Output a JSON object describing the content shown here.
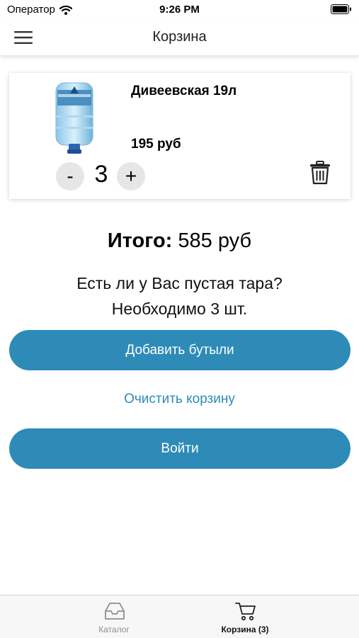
{
  "status_bar": {
    "carrier": "Оператор",
    "time": "9:26 PM"
  },
  "header": {
    "title": "Корзина",
    "menu_icon": "menu-icon"
  },
  "cart_item": {
    "name": "Дивеевская 19л",
    "price": "195 руб",
    "quantity": "3",
    "minus_label": "-",
    "plus_label": "+",
    "delete_icon": "trash-icon"
  },
  "summary": {
    "total_label": "Итого:",
    "total_value": "585 руб",
    "tara_question": "Есть ли у Вас пустая тара?",
    "tara_needed": "Необходимо 3 шт."
  },
  "actions": {
    "add_bottles": "Добавить бутыли",
    "clear_cart": "Очистить корзину",
    "login": "Войти"
  },
  "tab_bar": {
    "tabs": [
      {
        "label": "Каталог",
        "icon": "inbox-icon",
        "active": false
      },
      {
        "label": "Корзина (3)",
        "icon": "cart-icon",
        "active": true
      }
    ]
  },
  "colors": {
    "accent": "#2e8bb8",
    "qty_button_bg": "#e6e6e6",
    "inactive_tab": "#8e8e8e"
  }
}
